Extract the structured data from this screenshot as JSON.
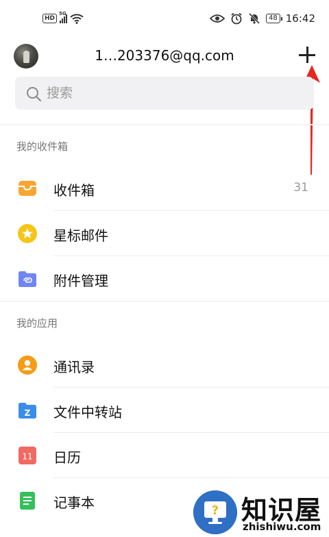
{
  "status_bar": {
    "hd": "HD",
    "network": "5G",
    "time": "16:42",
    "battery": "48"
  },
  "header": {
    "account": "1…203376@qq.com"
  },
  "search": {
    "placeholder": "搜索"
  },
  "sections": {
    "inbox_title": "我的收件箱",
    "apps_title": "我的应用"
  },
  "inbox_items": [
    {
      "label": "收件箱",
      "count": "31",
      "icon": "inbox-tray-icon"
    },
    {
      "label": "星标邮件",
      "icon": "star-icon"
    },
    {
      "label": "附件管理",
      "icon": "attachment-folder-icon"
    }
  ],
  "app_items": [
    {
      "label": "通讯录",
      "icon": "contacts-icon"
    },
    {
      "label": "文件中转站",
      "icon": "file-transfer-icon",
      "icon_letter": "Z"
    },
    {
      "label": "日历",
      "icon": "calendar-icon",
      "icon_number": "11"
    },
    {
      "label": "记事本",
      "icon": "notepad-icon"
    }
  ],
  "colors": {
    "inbox": "#f7a633",
    "star": "#f5c518",
    "attachment": "#6f86f2",
    "contacts": "#f59b14",
    "file_transfer": "#3a8eea",
    "calendar": "#f06a61",
    "notepad": "#34c05a",
    "annotation_arrow": "#e8261f"
  },
  "watermark": {
    "title": "知识屋",
    "url": "zhishiwu.com"
  }
}
